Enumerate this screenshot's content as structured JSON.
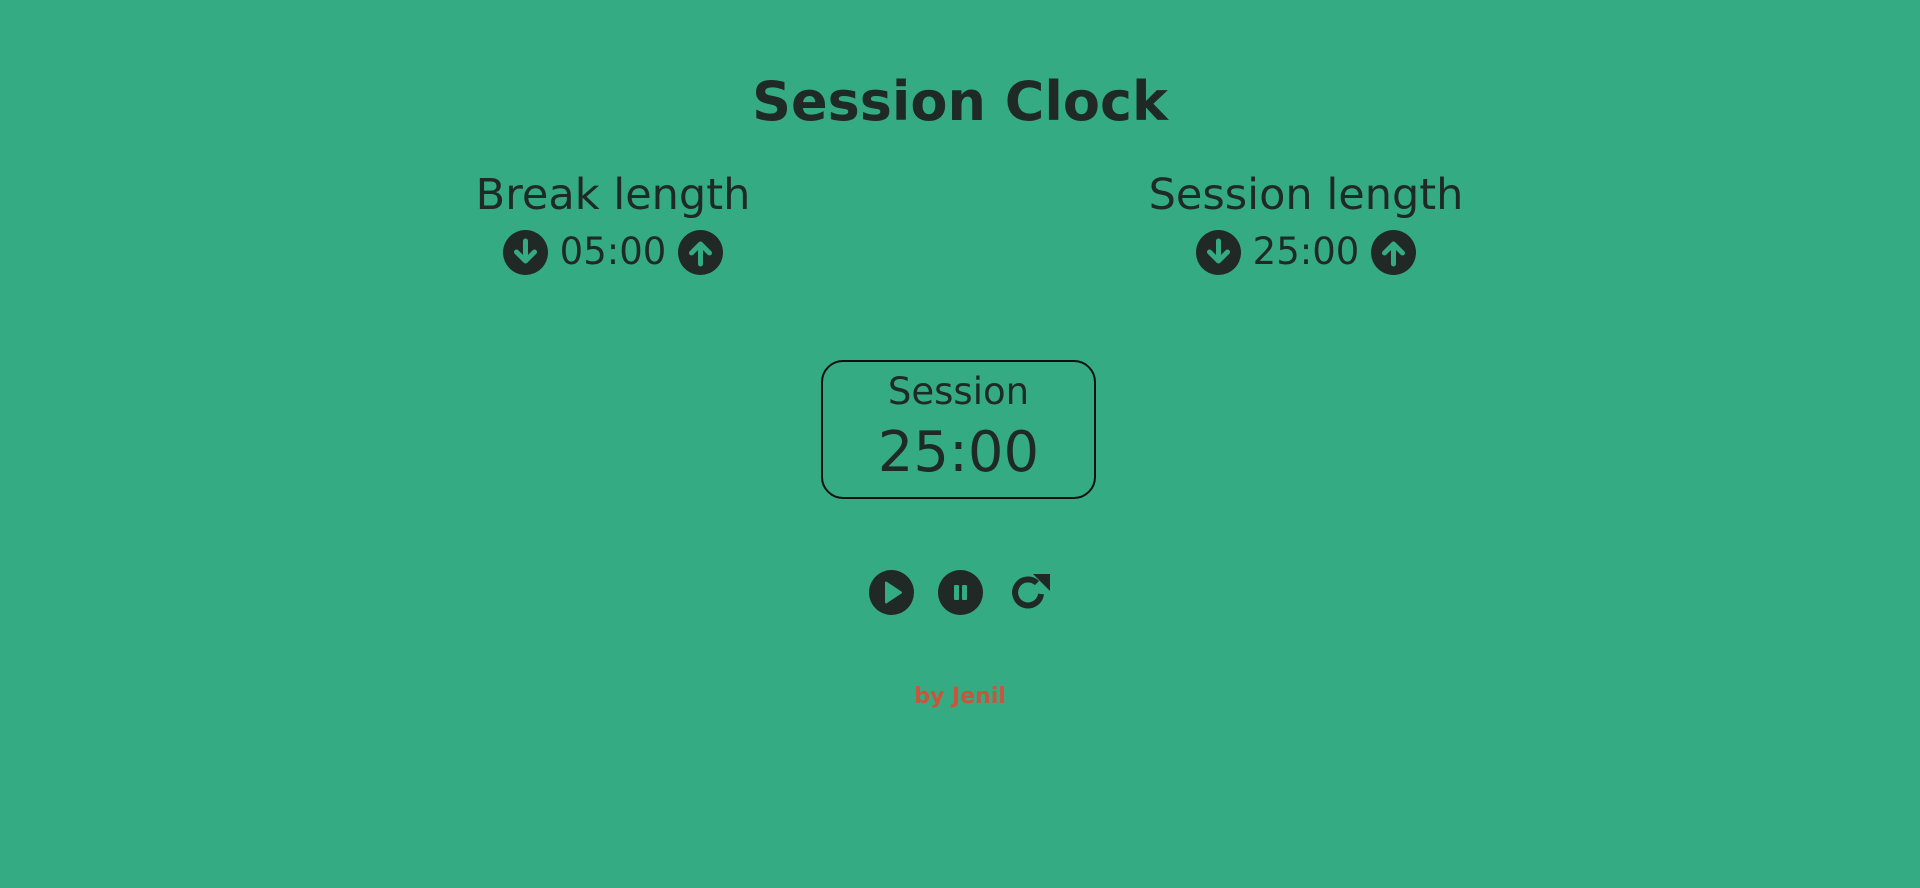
{
  "app": {
    "title": "Session Clock"
  },
  "break_length": {
    "label": "Break length",
    "value": "05:00",
    "decrement_icon": "arrow-circle-down-icon",
    "increment_icon": "arrow-circle-up-icon"
  },
  "session_length": {
    "label": "Session length",
    "value": "25:00",
    "decrement_icon": "arrow-circle-down-icon",
    "increment_icon": "arrow-circle-up-icon"
  },
  "timer": {
    "label": "Session",
    "value": "25:00"
  },
  "controls": {
    "play_icon": "play-circle-icon",
    "pause_icon": "pause-circle-icon",
    "reset_icon": "reset-icon"
  },
  "footer": {
    "credit": "by Jenil"
  },
  "colors": {
    "background": "#35ab84",
    "text": "#1f2a27",
    "button": "#212927",
    "credit": "#c9553a"
  }
}
